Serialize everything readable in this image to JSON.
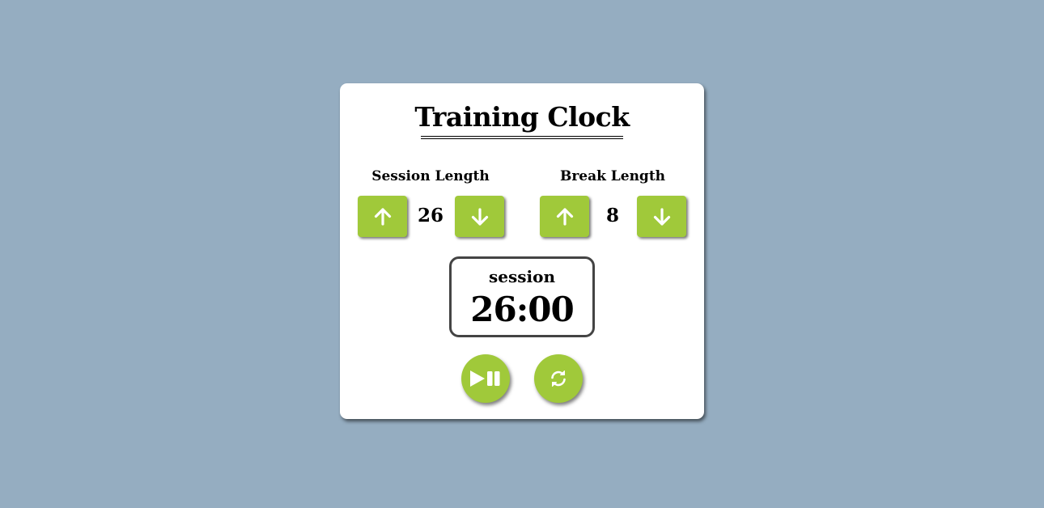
{
  "app": {
    "title": "Training Clock"
  },
  "session": {
    "label": "Session Length",
    "value": "26",
    "increment_icon": "arrow-up-icon",
    "decrement_icon": "arrow-down-icon"
  },
  "break": {
    "label": "Break Length",
    "value": "8",
    "increment_icon": "arrow-up-icon",
    "decrement_icon": "arrow-down-icon"
  },
  "timer": {
    "mode": "session",
    "display": "26:00"
  },
  "controls": {
    "play_pause_icon": "play-pause-icon",
    "reset_icon": "refresh-icon"
  },
  "colors": {
    "background": "#95adc1",
    "card": "#ffffff",
    "accent": "#a0c93a",
    "timer_border": "#444444"
  }
}
